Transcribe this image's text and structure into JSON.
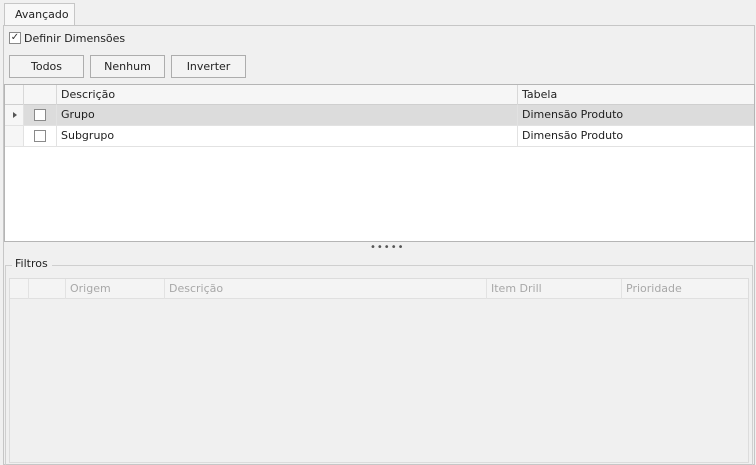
{
  "tab": {
    "label": "Avançado"
  },
  "definir_dimensoes": {
    "label": "Definir Dimensões",
    "checked": true
  },
  "buttons": {
    "todos": "Todos",
    "nenhum": "Nenhum",
    "inverter": "Inverter"
  },
  "grid": {
    "columns": [
      "Descrição",
      "Tabela"
    ],
    "rows": [
      {
        "descricao": "Grupo",
        "tabela": "Dimensão Produto",
        "checked": false,
        "selected": true
      },
      {
        "descricao": "Subgrupo",
        "tabela": "Dimensão Produto",
        "checked": false,
        "selected": false
      }
    ]
  },
  "splitter": {
    "glyph": "•••••"
  },
  "filtros": {
    "title": "Filtros",
    "columns": [
      "Origem",
      "Descrição",
      "Item Drill",
      "Prioridade"
    ]
  },
  "icons": {
    "check": "check-icon",
    "row_indicator": "row-arrow-icon"
  },
  "colors": {
    "selected_row": "#dcdcdc",
    "disabled_text": "#a8a8a8"
  }
}
